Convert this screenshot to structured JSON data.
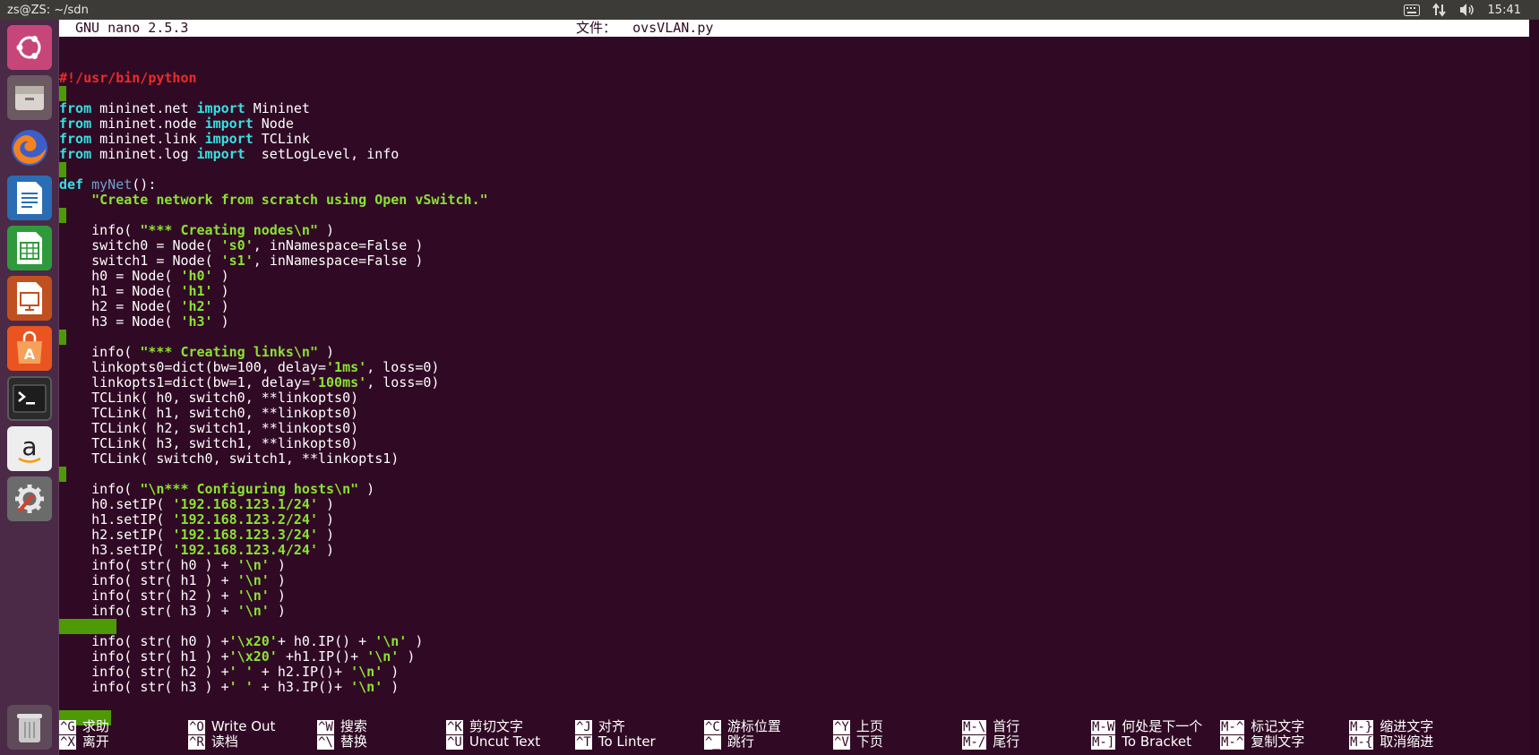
{
  "window": {
    "title": "zs@ZS: ~/sdn"
  },
  "tray": {
    "icons": [
      "keyboard-icon",
      "network-icon",
      "volume-icon"
    ],
    "clock": "15:41"
  },
  "launcher": {
    "items": [
      "ubuntu-dash",
      "files",
      "firefox",
      "libreoffice-writer",
      "libreoffice-calc",
      "libreoffice-impress",
      "ubuntu-software",
      "terminal",
      "amazon",
      "system-settings",
      "trash"
    ]
  },
  "nano": {
    "version": "GNU nano 2.5.3",
    "file_label": "文件：",
    "file_name": "ovsVLAN.py"
  },
  "code_lines": [
    "#!/usr/bin/python",
    "",
    "from mininet.net import Mininet",
    "from mininet.node import Node",
    "from mininet.link import TCLink",
    "from mininet.log import  setLogLevel, info",
    "",
    "def myNet():",
    "    \"Create network from scratch using Open vSwitch.\"",
    "",
    "    info( \"*** Creating nodes\\n\" )",
    "    switch0 = Node( 's0', inNamespace=False )",
    "    switch1 = Node( 's1', inNamespace=False )",
    "    h0 = Node( 'h0' )",
    "    h1 = Node( 'h1' )",
    "    h2 = Node( 'h2' )",
    "    h3 = Node( 'h3' )",
    "",
    "    info( \"*** Creating links\\n\" )",
    "    linkopts0=dict(bw=100, delay='1ms', loss=0)",
    "    linkopts1=dict(bw=1, delay='100ms', loss=0)",
    "    TCLink( h0, switch0, **linkopts0)",
    "    TCLink( h1, switch0, **linkopts0)",
    "    TCLink( h2, switch1, **linkopts0)",
    "    TCLink( h3, switch1, **linkopts0)",
    "    TCLink( switch0, switch1, **linkopts1)",
    "",
    "    info( \"\\n*** Configuring hosts\\n\" )",
    "    h0.setIP( '192.168.123.1/24' )",
    "    h1.setIP( '192.168.123.2/24' )",
    "    h2.setIP( '192.168.123.3/24' )",
    "    h3.setIP( '192.168.123.4/24' )",
    "    info( str( h0 ) + '\\n' )",
    "    info( str( h1 ) + '\\n' )",
    "    info( str( h2 ) + '\\n' )",
    "    info( str( h3 ) + '\\n' )",
    "",
    "    info( str( h0 ) +'\\x20'+ h0.IP() + '\\n' )",
    "    info( str( h1 ) +'\\x20' +h1.IP()+ '\\n' )",
    "    info( str( h2 ) +' ' + h2.IP()+ '\\n' )",
    "    info( str( h3 ) +' ' + h3.IP()+ '\\n' )",
    "",
    ""
  ],
  "shortcuts": [
    {
      "key": "^G",
      "label": "求助"
    },
    {
      "key": "^X",
      "label": "离开"
    },
    {
      "key": "^O",
      "label": "Write Out"
    },
    {
      "key": "^R",
      "label": "读档"
    },
    {
      "key": "^W",
      "label": "搜索"
    },
    {
      "key": "^\\",
      "label": "替换"
    },
    {
      "key": "^K",
      "label": "剪切文字"
    },
    {
      "key": "^U",
      "label": "Uncut Text"
    },
    {
      "key": "^J",
      "label": "对齐"
    },
    {
      "key": "^T",
      "label": "To Linter"
    },
    {
      "key": "^C",
      "label": "游标位置"
    },
    {
      "key": "^_",
      "label": "跳行"
    },
    {
      "key": "^Y",
      "label": "上页"
    },
    {
      "key": "^V",
      "label": "下页"
    },
    {
      "key": "M-\\",
      "label": "首行"
    },
    {
      "key": "M-/",
      "label": "尾行"
    },
    {
      "key": "M-W",
      "label": "何处是下一个"
    },
    {
      "key": "M-]",
      "label": "To Bracket"
    },
    {
      "key": "M-^",
      "label": "标记文字"
    },
    {
      "key": "M-^",
      "label": "复制文字"
    },
    {
      "key": "M-}",
      "label": "缩进文字"
    },
    {
      "key": "M-{",
      "label": "取消缩进"
    }
  ]
}
